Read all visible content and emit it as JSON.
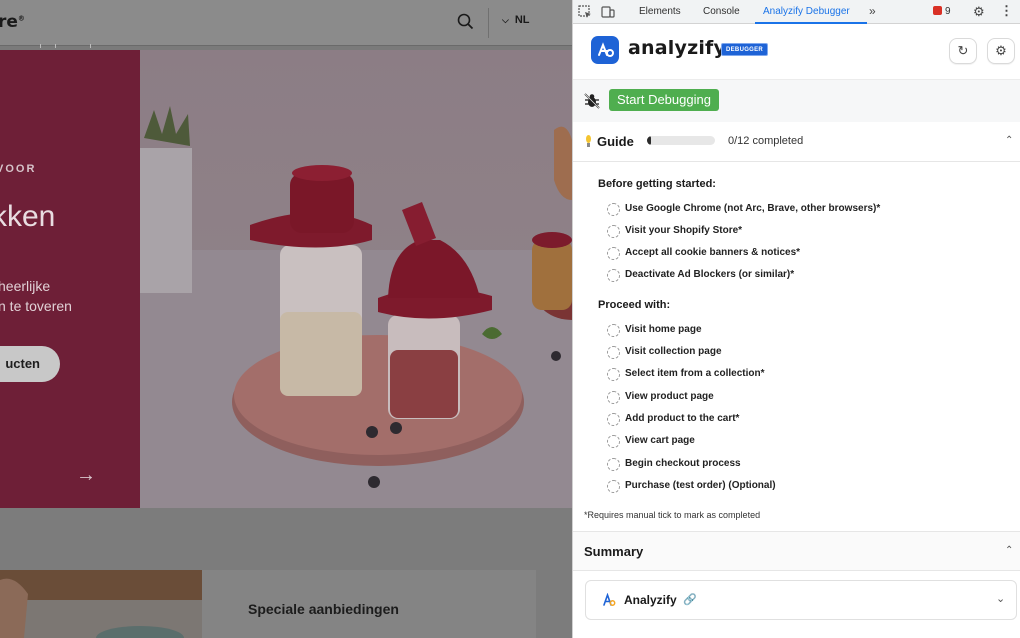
{
  "website": {
    "logo": "re",
    "logo_mark": "®",
    "language": "NL",
    "hero": {
      "eyebrow": "VOOR",
      "title": "kken",
      "subtitle_line1": "heerlijke",
      "subtitle_line2": "n te toveren",
      "button_label": "ucten",
      "arrow": "→"
    },
    "special_offers": "Speciale aanbiedingen"
  },
  "devtools": {
    "tabs": [
      "Elements",
      "Console",
      "Analyzify Debugger"
    ],
    "active_tab": "Analyzify Debugger",
    "more_tabs": "»",
    "issues_count": "9",
    "accent_color": "#1a73e8",
    "error_color": "#d93025"
  },
  "analyzify": {
    "brand_name": "analyzify",
    "badge": "DEBUGGER",
    "brand_color": "#1e63d6",
    "start_button": "Start Debugging",
    "start_color": "#4fae4f",
    "guide": {
      "label": "Guide",
      "progress": 0.06,
      "progress_text": "0/12 completed",
      "before_title": "Before getting started:",
      "before_items": [
        "Use Google Chrome (not Arc, Brave, other browsers)*",
        "Visit your Shopify Store*",
        "Accept all cookie banners & notices*",
        "Deactivate Ad Blockers (or similar)*"
      ],
      "proceed_title": "Proceed with:",
      "proceed_items": [
        "Visit home page",
        "Visit collection page",
        "Select item from a collection*",
        "View product page",
        "Add product to the cart*",
        "View cart page",
        "Begin checkout process",
        "Purchase (test order) (Optional)"
      ],
      "footnote": "*Requires manual tick to mark as completed"
    },
    "summary": {
      "label": "Summary",
      "card_name": "Analyzify"
    }
  }
}
